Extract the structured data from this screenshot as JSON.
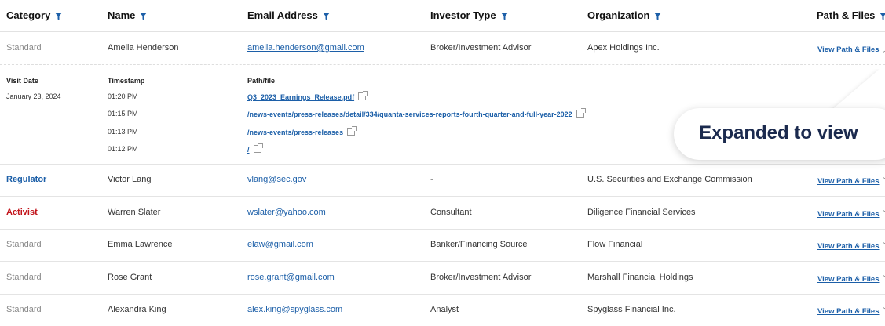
{
  "columns": {
    "category": "Category",
    "name": "Name",
    "email": "Email Address",
    "investor_type": "Investor Type",
    "organization": "Organization",
    "path_files": "Path & Files"
  },
  "rows": [
    {
      "category": "Standard",
      "category_style": "standard",
      "name": "Amelia Henderson",
      "email": "amelia.henderson@gmail.com",
      "investor_type": "Broker/Investment Advisor",
      "organization": "Apex Holdings Inc.",
      "action": "View Path & Files",
      "expanded": true
    },
    {
      "category": "Regulator",
      "category_style": "regulator",
      "name": "Victor Lang",
      "email": "vlang@sec.gov",
      "investor_type": "-",
      "organization": "U.S. Securities and Exchange Commission",
      "action": "View Path & Files"
    },
    {
      "category": "Activist",
      "category_style": "activist",
      "name": "Warren Slater",
      "email": "wslater@yahoo.com",
      "investor_type": "Consultant",
      "organization": "Diligence Financial Services",
      "action": "View Path & Files"
    },
    {
      "category": "Standard",
      "category_style": "standard",
      "name": "Emma Lawrence",
      "email": "elaw@gmail.com",
      "investor_type": "Banker/Financing Source",
      "organization": "Flow Financial",
      "action": "View Path & Files"
    },
    {
      "category": "Standard",
      "category_style": "standard",
      "name": "Rose Grant",
      "email": "rose.grant@gmail.com",
      "investor_type": "Broker/Investment Advisor",
      "organization": "Marshall Financial Holdings",
      "action": "View Path & Files"
    },
    {
      "category": "Standard",
      "category_style": "standard",
      "name": "Alexandra King",
      "email": "alex.king@spyglass.com",
      "investor_type": "Analyst",
      "organization": "Spyglass Financial Inc.",
      "action": "View Path & Files"
    }
  ],
  "expanded": {
    "visit_date_label": "Visit Date",
    "timestamp_label": "Timestamp",
    "path_label": "Path/file",
    "visit_date": "January 23, 2024",
    "entries": [
      {
        "time": "01:20 PM",
        "path": "Q3_2023_Earnings_Release.pdf"
      },
      {
        "time": "01:15 PM",
        "path": "/news-events/press-releases/detail/334/quanta-services-reports-fourth-quarter-and-full-year-2022"
      },
      {
        "time": "01:13 PM",
        "path": "/news-events/press-releases"
      },
      {
        "time": "01:12 PM",
        "path": "/"
      }
    ]
  },
  "callout": {
    "text": "Expanded to view"
  },
  "colors": {
    "link": "#1c5fa8",
    "activist": "#c2141b",
    "regulator": "#1c5fa8",
    "standard": "#8a8a8a",
    "callout_text": "#1b2a4e"
  },
  "icons": {
    "filter": "filter-funnel-icon",
    "external": "external-link-icon",
    "chevron_down": "chevron-down-icon",
    "chevron_up": "chevron-up-icon"
  }
}
